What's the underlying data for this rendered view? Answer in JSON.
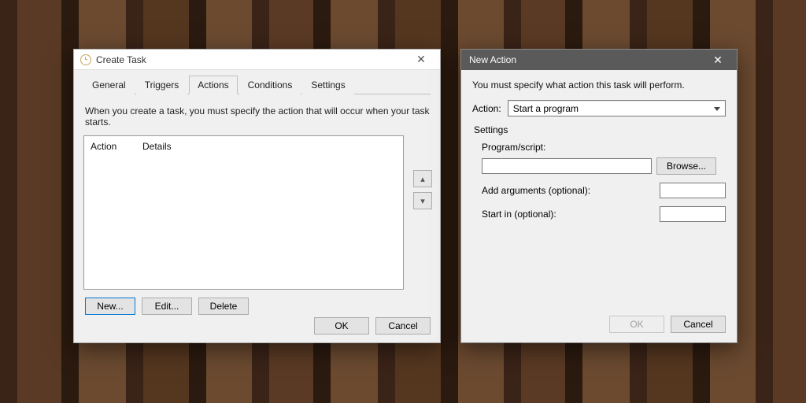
{
  "create_task": {
    "title": "Create Task",
    "tabs": [
      "General",
      "Triggers",
      "Actions",
      "Conditions",
      "Settings"
    ],
    "active_tab_index": 2,
    "help_text": "When you create a task, you must specify the action that will occur when your task starts.",
    "columns": {
      "action": "Action",
      "details": "Details"
    },
    "side": {
      "up": "▴",
      "down": "▾"
    },
    "buttons": {
      "new": "New...",
      "edit": "Edit...",
      "delete": "Delete"
    },
    "footer": {
      "ok": "OK",
      "cancel": "Cancel"
    }
  },
  "new_action": {
    "title": "New Action",
    "desc": "You must specify what action this task will perform.",
    "action_label": "Action:",
    "action_value": "Start a program",
    "settings_label": "Settings",
    "program_label": "Program/script:",
    "browse": "Browse...",
    "args_label": "Add arguments (optional):",
    "startin_label": "Start in (optional):",
    "program_value": "",
    "args_value": "",
    "startin_value": "",
    "footer": {
      "ok": "OK",
      "cancel": "Cancel"
    }
  }
}
